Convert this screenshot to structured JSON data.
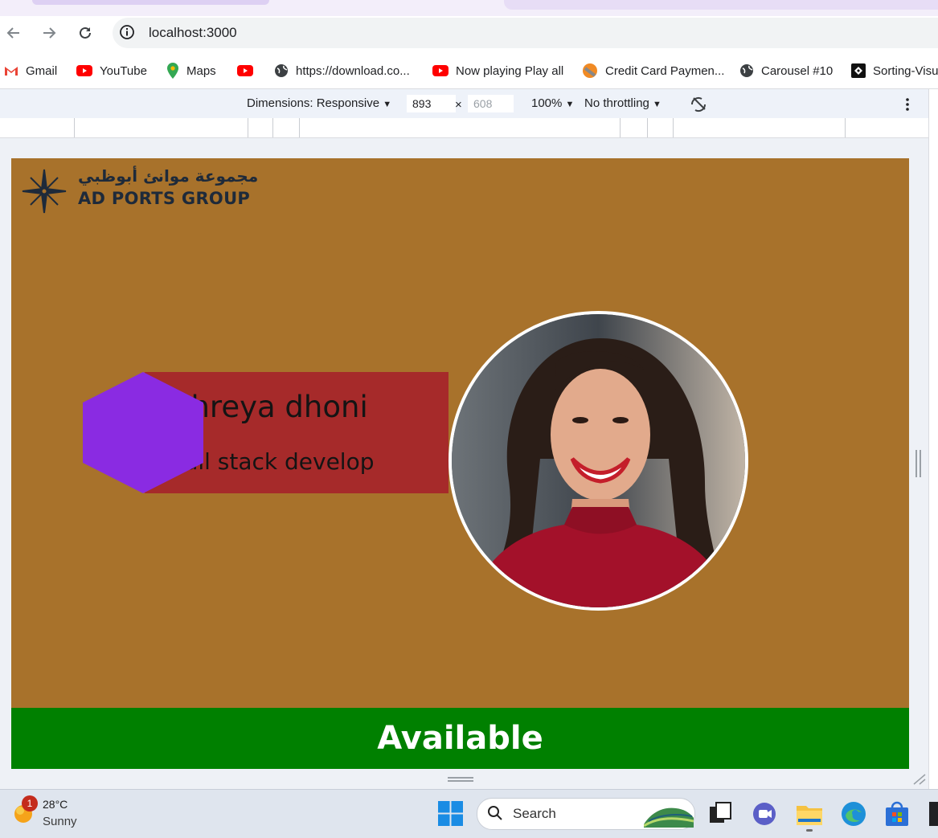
{
  "browser": {
    "url": "localhost:3000",
    "bookmarks": [
      {
        "label": "Gmail",
        "icon": "gmail-icon"
      },
      {
        "label": "YouTube",
        "icon": "youtube-icon"
      },
      {
        "label": "Maps",
        "icon": "maps-icon"
      },
      {
        "label": "",
        "icon": "youtube-icon"
      },
      {
        "label": "https://download.co...",
        "icon": "globe-icon"
      },
      {
        "label": "Now playing Play all",
        "icon": "youtube-icon"
      },
      {
        "label": "Credit Card Paymen...",
        "icon": "credit-card-site-icon"
      },
      {
        "label": "Carousel #10",
        "icon": "globe-icon"
      },
      {
        "label": "Sorting-Visu",
        "icon": "sorting-site-icon"
      }
    ]
  },
  "device_toolbar": {
    "dimensions_label": "Dimensions: Responsive",
    "width_value": "893",
    "times": "×",
    "height_value": "608",
    "zoom": "100%",
    "throttling": "No throttling"
  },
  "page": {
    "background_color": "#a8722b",
    "logo": {
      "arabic": "مجموعة موانئ أبوظبي",
      "english": "AD PORTS GROUP"
    },
    "profile": {
      "name": "Shreya dhoni",
      "role": "Full stack developer"
    },
    "status": {
      "label": "Available",
      "color": "#008000"
    },
    "accent_colors": {
      "card": "#a62a2a",
      "hexagon": "#8a2be2"
    }
  },
  "taskbar": {
    "weather_badge": "1",
    "temperature": "28°C",
    "condition": "Sunny",
    "search_label": "Search"
  }
}
